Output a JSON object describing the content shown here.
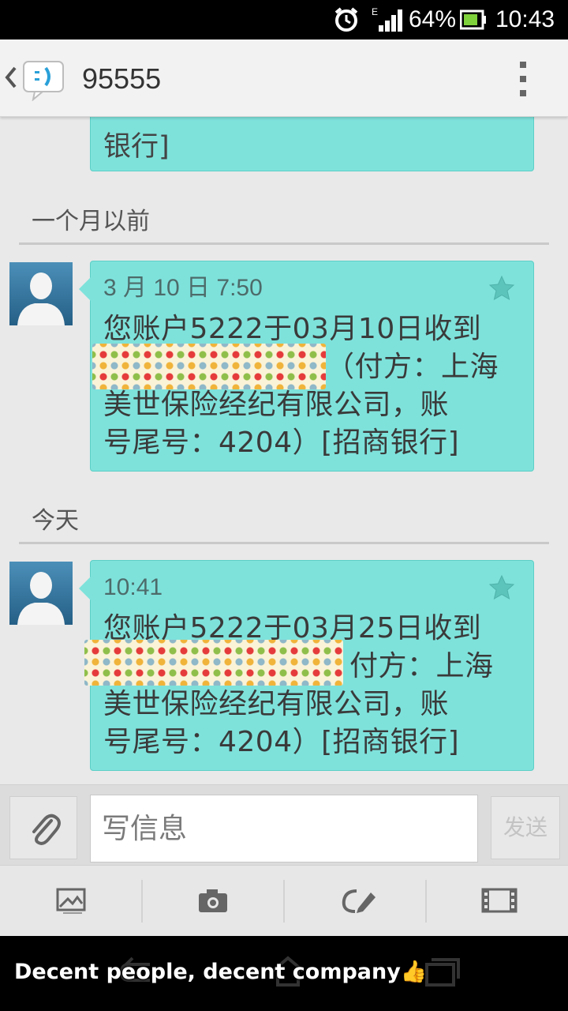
{
  "status_bar": {
    "battery_percent": "64%",
    "time": "10:43",
    "network_type": "E"
  },
  "action_bar": {
    "title": "95555"
  },
  "conversation": {
    "partial_message": {
      "visible_text": "银行]"
    },
    "groups": [
      {
        "label": "一个月以前",
        "message": {
          "timestamp": "3 月 10 日 7:50",
          "line1": "您账户5222于03月10日收到",
          "line2_rest": "（付方：上海",
          "line3": "美世保险经纪有限公司，账",
          "line4": "号尾号：4204）[招商银行]"
        }
      },
      {
        "label": "今天",
        "message": {
          "timestamp": "10:41",
          "line1": "您账户5222于03月25日收到",
          "line2_rest": "付方：上海",
          "line3": "美世保险经纪有限公司，账",
          "line4": "号尾号：4204）[招商银行]"
        }
      }
    ]
  },
  "compose": {
    "placeholder": "写信息",
    "send_label": "发送"
  },
  "media_toolbar": {
    "icons": [
      "image-icon",
      "camera-icon",
      "doodle-icon",
      "video-icon"
    ]
  },
  "caption": {
    "text": "Decent people, decent company👍"
  },
  "colors": {
    "bubble": "#7ee2db",
    "avatar": "#2f6f98",
    "status_bar": "#000000"
  }
}
